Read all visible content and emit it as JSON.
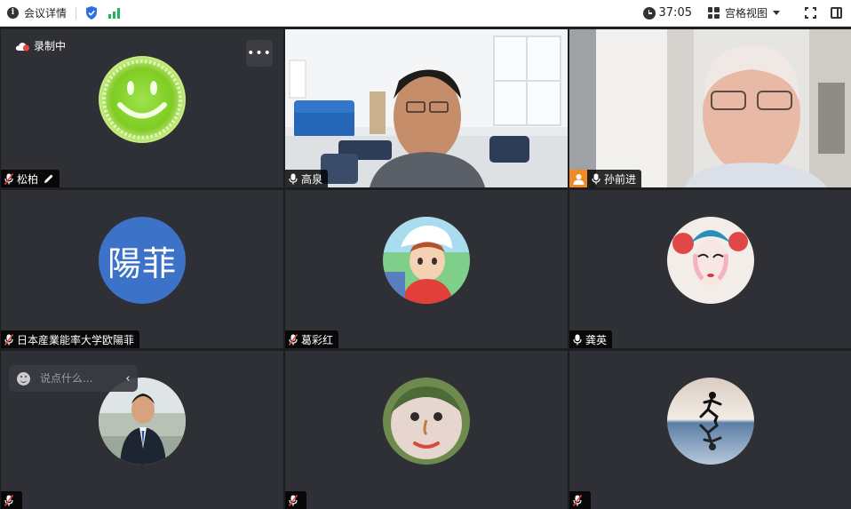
{
  "topbar": {
    "meeting_detail_label": "会议详情",
    "timer": "37:05",
    "view_mode_label": "宫格视图"
  },
  "colors": {
    "active_speaker_outline": "#1fb35a",
    "host_badge": "#f08a24",
    "tile_background": "#2e3035",
    "signal_bars": "#22b35e"
  },
  "participants": [
    {
      "name": "松柏",
      "avatar": "smiley-face",
      "mic": "muted",
      "editable_name": true,
      "recording_label": "录制中"
    },
    {
      "name": "高泉",
      "avatar": "camera-video",
      "mic": "on",
      "active_speaker": true
    },
    {
      "name": "孙前进",
      "avatar": "camera-video",
      "mic": "on",
      "host": true
    },
    {
      "name": "日本産業能率大学欧陽菲",
      "avatar_text": "陽菲",
      "mic": "muted"
    },
    {
      "name": "葛彩红",
      "avatar": "anime-boy",
      "mic": "muted"
    },
    {
      "name": "龚英",
      "avatar": "opera-mask",
      "mic": "on"
    },
    {
      "name": "",
      "avatar": "man-in-suit",
      "mic": "muted"
    },
    {
      "name": "",
      "avatar": "stone-face",
      "mic": "muted"
    },
    {
      "name": "",
      "avatar": "runner-reflection",
      "mic": "muted"
    }
  ],
  "chat": {
    "placeholder": "说点什么..."
  }
}
